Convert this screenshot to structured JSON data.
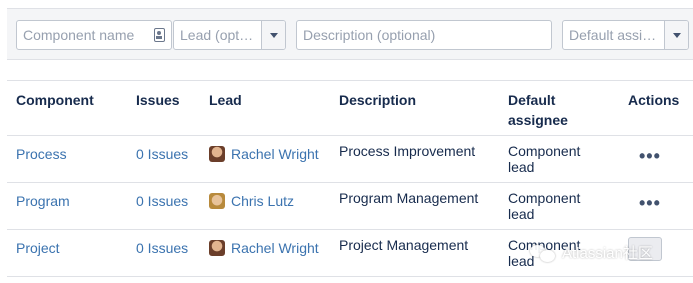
{
  "filters": {
    "component_name_placeholder": "Component name",
    "lead_placeholder": "Lead (opt…",
    "description_placeholder": "Description (optional)",
    "assignee_placeholder": "Default assi…"
  },
  "table": {
    "headers": {
      "component": "Component",
      "issues": "Issues",
      "lead": "Lead",
      "description": "Description",
      "assignee": "Default assignee",
      "actions": "Actions"
    },
    "rows": [
      {
        "component": "Process",
        "issues": "0 Issues",
        "lead": "Rachel Wright",
        "description": "Process Improvement",
        "assignee": "Component lead",
        "actions": "•••"
      },
      {
        "component": "Program",
        "issues": "0 Issues",
        "lead": "Chris Lutz",
        "description": "Program Management",
        "assignee": "Component lead",
        "actions": "•••"
      },
      {
        "component": "Project",
        "issues": "0 Issues",
        "lead": "Rachel Wright",
        "description": "Project Management",
        "assignee": "Component lead",
        "actions": "•••"
      }
    ]
  },
  "watermark": {
    "text": "Atlassian社区"
  }
}
